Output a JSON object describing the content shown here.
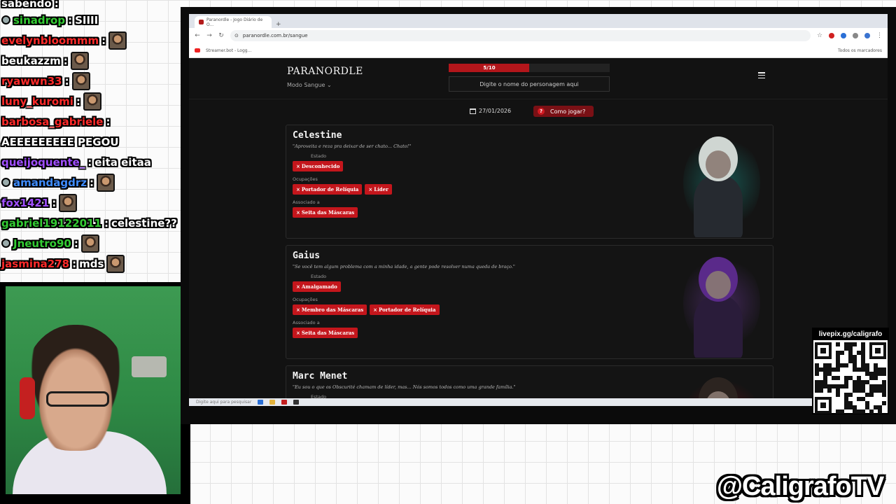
{
  "chat": [
    {
      "user": "sabendo",
      "message": "",
      "user_color": "#ffffff",
      "badge": false,
      "emote": false
    },
    {
      "user": "sinadrop",
      "message": "SIIII",
      "user_color": "#33cc33",
      "badge": true,
      "emote": false
    },
    {
      "user": "evelynbloommm",
      "message": "",
      "user_color": "#ff2a2a",
      "badge": false,
      "emote": true
    },
    {
      "user": "beukazzm",
      "message": "",
      "user_color": "#ffffff",
      "badge": false,
      "emote": true
    },
    {
      "user": "ryawwn33",
      "message": "",
      "user_color": "#ff2a2a",
      "badge": false,
      "emote": true
    },
    {
      "user": "luny_kuromi",
      "message": "",
      "user_color": "#ff2a2a",
      "badge": false,
      "emote": true
    },
    {
      "user": "barbosa_gabriele",
      "message": "",
      "user_color": "#ff2a2a",
      "badge": false,
      "emote": false
    },
    {
      "user": "",
      "message": "AEEEEEEEEE PEGOU",
      "user_color": "#ffffff",
      "badge": false,
      "emote": false
    },
    {
      "user": "queijoquente_",
      "message": "eita eitaa",
      "user_color": "#a04fff",
      "badge": false,
      "emote": false
    },
    {
      "user": "amandagdrz",
      "message": "",
      "user_color": "#3f8cff",
      "badge": true,
      "emote": true
    },
    {
      "user": "fox1421",
      "message": "",
      "user_color": "#a04fff",
      "badge": false,
      "emote": true
    },
    {
      "user": "gabriel19122011",
      "message": "celestine??",
      "user_color": "#33cc33",
      "badge": false,
      "emote": false
    },
    {
      "user": "Jneutro90",
      "message": "",
      "user_color": "#33cc33",
      "badge": true,
      "emote": true
    },
    {
      "user": "jasmina278",
      "message": "mds",
      "user_color": "#ff2a2a",
      "badge": false,
      "emote": true
    }
  ],
  "browser": {
    "tab_title": "Paranordle - Jogo Diário de O...",
    "url": "paranordle.com.br/sangue",
    "bookmark": "Streamer.bot - Logg...",
    "bookmark_right": "Todos os marcadores",
    "taskbar_search": "Digite aqui para pesquisar"
  },
  "site": {
    "logo": "PARANORDLE",
    "mode": "Modo Sangue ⌄",
    "progress_label": "5/10",
    "progress_fraction": 0.5,
    "search_placeholder": "Digite o nome do personagem aqui",
    "date": "27/01/2026",
    "how_to_play": "Como jogar?",
    "how_icon": "?"
  },
  "cards": [
    {
      "name": "Celestine",
      "quote": "\"Aproveita e reza pra deixar de ser chato... Chato!\"",
      "estado_label": "Estado",
      "estado": [
        "Desconhecido"
      ],
      "ocupacoes_label": "Ocupações",
      "ocupacoes": [
        "Portador de Relíquia",
        "Líder"
      ],
      "associado_label": "Associado a",
      "associado": [
        "Seita das Máscaras"
      ]
    },
    {
      "name": "Gaius",
      "quote": "\"Se você tem algum problema com a minha idade, a gente pode resolver numa queda de braço.\"",
      "estado_label": "Estado",
      "estado": [
        "Amalgamado"
      ],
      "ocupacoes_label": "Ocupações",
      "ocupacoes": [
        "Membro das Máscaras",
        "Portador de Relíquia"
      ],
      "associado_label": "Associado a",
      "associado": [
        "Seita das Máscaras"
      ]
    },
    {
      "name": "Marc Menet",
      "quote": "\"Eu sou o que os Obscurité chamam de líder, mas... Nós somos todos como uma grande família.\"",
      "estado_label": "Estado",
      "estado": [],
      "ocupacoes_label": "",
      "ocupacoes": [],
      "associado_label": "",
      "associado": []
    }
  ],
  "tag_mark": "×",
  "overlay": {
    "qr_caption": "livepix.gg/caligrafo",
    "handle": "@CaligrafoTV"
  },
  "colors": {
    "accent_red": "#c4161c",
    "page_bg": "#121212"
  }
}
